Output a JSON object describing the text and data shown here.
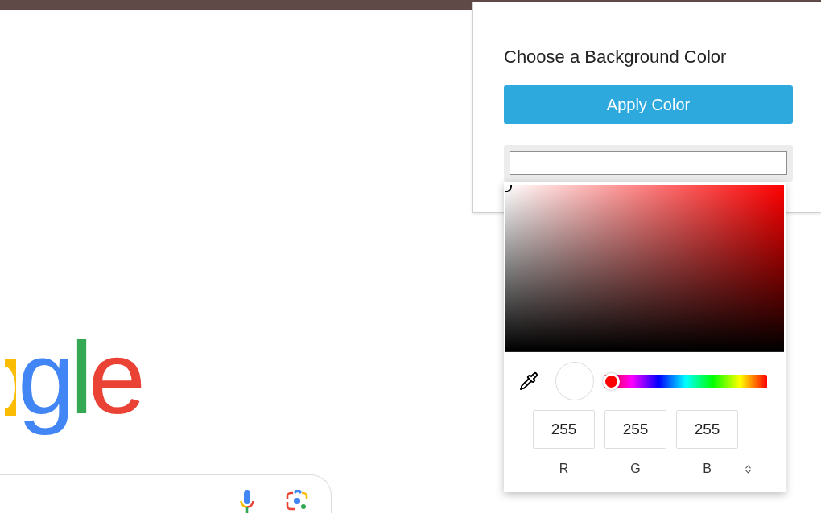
{
  "page": {
    "logo": {
      "letters": [
        {
          "char": "g",
          "color": "#4285f4"
        },
        {
          "char": "l",
          "color": "#34a853"
        },
        {
          "char": "e",
          "color": "#ea4335"
        }
      ]
    }
  },
  "popup": {
    "title": "Choose a Background Color",
    "apply_button": "Apply Color"
  },
  "picker": {
    "hue_slider": {
      "level": 0
    },
    "channels": [
      {
        "value": "255",
        "label": "R"
      },
      {
        "value": "255",
        "label": "G"
      },
      {
        "value": "255",
        "label": "B"
      }
    ]
  }
}
